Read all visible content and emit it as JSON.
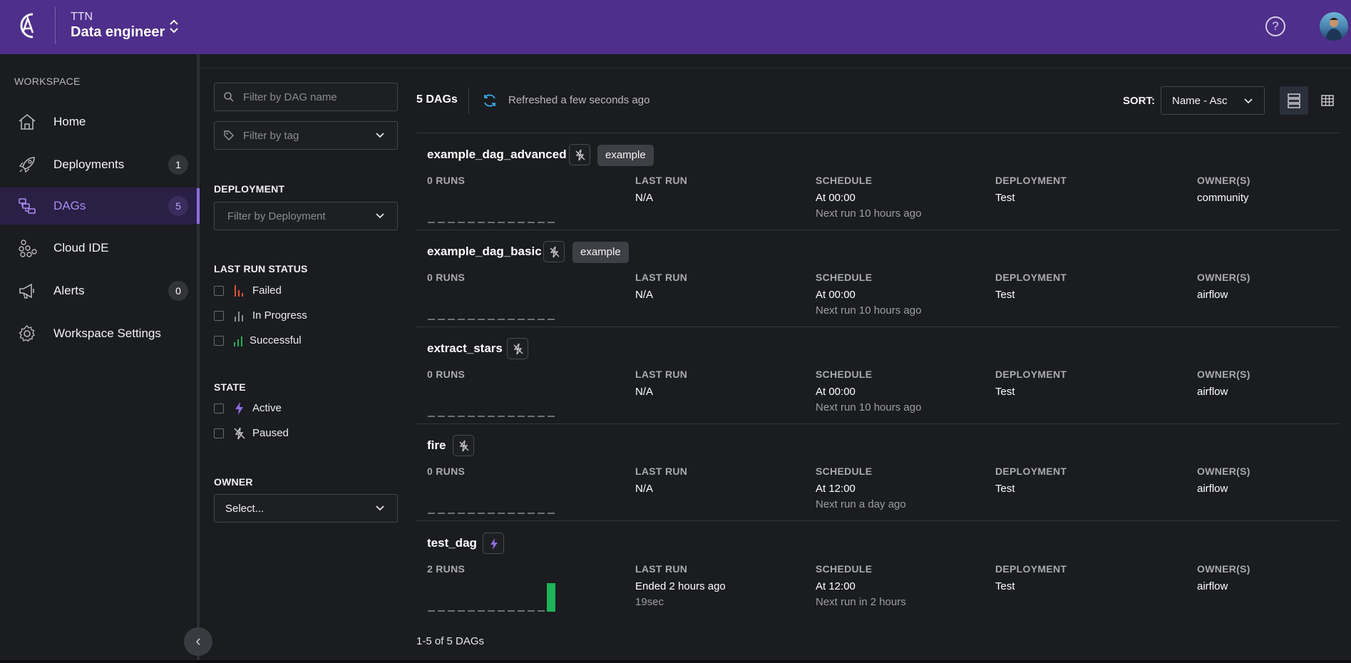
{
  "header": {
    "org": "TTN",
    "workspace": "Data engineer",
    "help_glyph": "?",
    "colors": {
      "header_bg": "#4e2f8c"
    }
  },
  "sidebar": {
    "section_label": "WORKSPACE",
    "items": [
      {
        "label": "Home",
        "icon": "home-icon",
        "badge": null
      },
      {
        "label": "Deployments",
        "icon": "rocket-icon",
        "badge": "1"
      },
      {
        "label": "DAGs",
        "icon": "dag-icon",
        "badge": "5",
        "active": true
      },
      {
        "label": "Cloud IDE",
        "icon": "cloud-ide-icon",
        "badge": null
      },
      {
        "label": "Alerts",
        "icon": "megaphone-icon",
        "badge": "0"
      },
      {
        "label": "Workspace Settings",
        "icon": "gear-icon",
        "badge": null
      }
    ],
    "collapse_glyph": "‹"
  },
  "filters": {
    "name_placeholder": "Filter by DAG name",
    "tag_placeholder": "Filter by tag",
    "deployment_title": "DEPLOYMENT",
    "deployment_placeholder": "Filter by Deployment",
    "last_run_title": "LAST RUN STATUS",
    "last_run_options": [
      "Failed",
      "In Progress",
      "Successful"
    ],
    "state_title": "STATE",
    "state_options": [
      "Active",
      "Paused"
    ],
    "owner_title": "OWNER",
    "owner_placeholder": "Select..."
  },
  "list": {
    "count": "5 DAGs",
    "refreshed": "Refreshed a few seconds ago",
    "sort_label": "SORT:",
    "sort_value": "Name - Asc",
    "labels": {
      "last_run": "LAST RUN",
      "schedule": "SCHEDULE",
      "deployment": "DEPLOYMENT",
      "owners": "OWNER(S)"
    },
    "dags": [
      {
        "name": "example_dag_advanced",
        "state": "paused",
        "tag": "example",
        "runs": "0 RUNS",
        "last_run": "N/A",
        "last_run_sub": "",
        "schedule": "At 00:00",
        "next_run": "Next run 10 hours ago",
        "deployment": "Test",
        "owner": "community",
        "success_bars": 0
      },
      {
        "name": "example_dag_basic",
        "state": "paused",
        "tag": "example",
        "runs": "0 RUNS",
        "last_run": "N/A",
        "last_run_sub": "",
        "schedule": "At 00:00",
        "next_run": "Next run 10 hours ago",
        "deployment": "Test",
        "owner": "airflow",
        "success_bars": 0
      },
      {
        "name": "extract_stars",
        "state": "paused",
        "tag": "",
        "runs": "0 RUNS",
        "last_run": "N/A",
        "last_run_sub": "",
        "schedule": "At 00:00",
        "next_run": "Next run 10 hours ago",
        "deployment": "Test",
        "owner": "airflow",
        "success_bars": 0
      },
      {
        "name": "fire",
        "state": "paused",
        "tag": "",
        "runs": "0 RUNS",
        "last_run": "N/A",
        "last_run_sub": "",
        "schedule": "At 12:00",
        "next_run": "Next run a day ago",
        "deployment": "Test",
        "owner": "airflow",
        "success_bars": 0
      },
      {
        "name": "test_dag",
        "state": "active",
        "tag": "",
        "runs": "2 RUNS",
        "last_run": "Ended 2 hours ago",
        "last_run_sub": "19sec",
        "schedule": "At 12:00",
        "next_run": "Next run in 2 hours",
        "deployment": "Test",
        "owner": "airflow",
        "success_bars": 2
      }
    ],
    "pager": "1-5 of 5 DAGs",
    "colors": {
      "success": "#1fb35a",
      "failed": "#e0543a",
      "accent": "#8c6fe0"
    }
  }
}
